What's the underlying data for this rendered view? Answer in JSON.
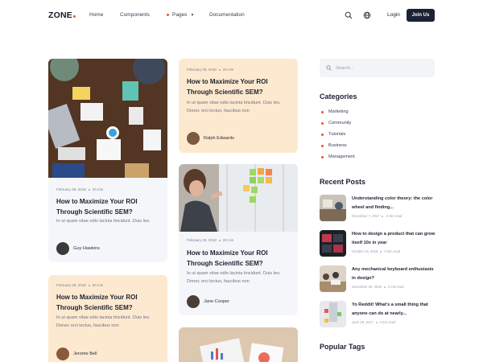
{
  "header": {
    "logo": "ZONE",
    "nav": [
      "Home",
      "Components",
      "Pages",
      "Documentation"
    ],
    "login": "Login",
    "join": "Join Us"
  },
  "cards": [
    {
      "date": "February 28, 2018",
      "read": "20 min",
      "title": "How to Maximize Your ROI Through Scientific SEM?",
      "excerpt": "In ut quam vitae odio lacinia tincidunt. Duis leo.",
      "author": "Guy Hawkins"
    },
    {
      "date": "February 28, 2018",
      "read": "20 min",
      "title": "How to Maximize Your ROI Through Scientific SEM?",
      "excerpt": "In ut quam vitae odio lacinia tincidunt. Duis leo. Donec orci lectus, faucibus non",
      "author": "Ralph Edwards"
    },
    {
      "date": "February 28, 2018",
      "read": "20 min",
      "title": "How to Maximize Your ROI Through Scientific SEM?",
      "excerpt": "In ut quam vitae odio lacinia tincidunt. Duis leo. Donec orci lectus, faucibus non",
      "author": "Jane Cooper"
    },
    {
      "date": "February 28, 2018",
      "read": "20 min",
      "title": "How to Maximize Your ROI Through Scientific SEM?",
      "excerpt": "In ut quam vitae odio lacinia tincidunt. Duis leo. Donec orci lectus, faucibus non",
      "author": "Jerome Bell"
    }
  ],
  "sidebar": {
    "search_placeholder": "Search...",
    "categories_title": "Categories",
    "categories": [
      "Marketing",
      "Community",
      "Tutorials",
      "Business",
      "Management"
    ],
    "recent_title": "Recent Posts",
    "recent": [
      {
        "title": "Understanding color theory: the color wheel and finding...",
        "date": "November 7, 2017",
        "read": "3 min read"
      },
      {
        "title": "How to design a product that can grow itself 10x in year",
        "date": "October 24, 2018",
        "read": "3 min read"
      },
      {
        "title": "Any mechanical keyboard enthusiasts in design?",
        "date": "November 28, 2018",
        "read": "3 min read"
      },
      {
        "title": "Yo Reddit! What's a small thing that anyone can do at nearly...",
        "date": "June 28, 2017",
        "read": "4 min read"
      }
    ],
    "tags_title": "Popular Tags"
  },
  "colors": {
    "accent": "#f0522f",
    "dark": "#1c2235",
    "peach": "#fde9cf",
    "light": "#f5f6fa"
  },
  "icons": [
    "search-icon",
    "globe-icon"
  ]
}
